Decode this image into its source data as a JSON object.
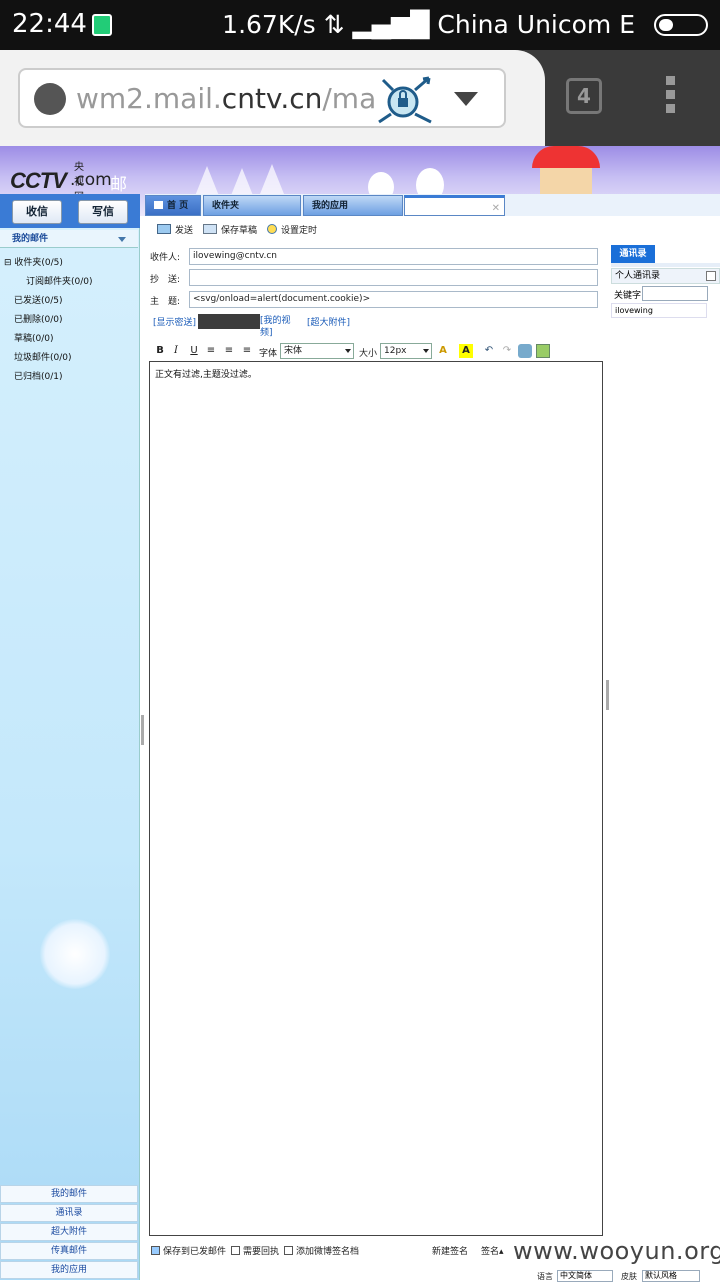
{
  "status_bar": {
    "time": "22:44",
    "network_speed": "1.67K/s",
    "carrier": "China Unicom E"
  },
  "browser": {
    "url_domain_prefix": "wm2.mail.",
    "url_domain_main": "cntv.cn",
    "url_rest": "/ma",
    "tab_count": "4"
  },
  "banner": {
    "logo_cctv": "CCTV",
    "logo_com": ".com",
    "logo_yangshi": "央视网",
    "logo_mailbox": "邮箱"
  },
  "sidebar": {
    "receive_button": "收信",
    "write_button": "写信",
    "my_mail_header": "我的邮件",
    "folders": [
      {
        "label": "收件夹(0/5)"
      },
      {
        "label": "订阅邮件夹(0/0)"
      },
      {
        "label": "已发送(0/5)"
      },
      {
        "label": "已删除(0/0)"
      },
      {
        "label": "草稿(0/0)"
      },
      {
        "label": "垃圾邮件(0/0)"
      },
      {
        "label": "已归档(0/1)"
      }
    ],
    "bottom_links": [
      {
        "label": "我的邮件"
      },
      {
        "label": "通讯录"
      },
      {
        "label": "超大附件"
      },
      {
        "label": "传真邮件"
      },
      {
        "label": "我的应用"
      }
    ]
  },
  "tabs": [
    {
      "label": "首 页"
    },
    {
      "label": "收件夹"
    },
    {
      "label": "我的应用"
    },
    {
      "label": ""
    }
  ],
  "toolbar": {
    "send": "发送",
    "save_draft": "保存草稿",
    "schedule": "设置定时"
  },
  "compose": {
    "to_label": "收件人:",
    "to_value": "ilovewing@cntv.cn",
    "cc_label": "抄　送:",
    "cc_value": "",
    "subject_label": "主　题:",
    "subject_value": "<svg/onload=alert(document.cookie)>",
    "show_bcc": "[显示密送]",
    "my_video": "[我的视频]",
    "large_attachment": "[超大附件]",
    "body_text": "正文有过滤,主题没过滤。"
  },
  "format_bar": {
    "font_label": "字体",
    "font_value": "宋体",
    "size_label": "大小",
    "size_value": "12px"
  },
  "contacts": {
    "tab_label": "通讯录",
    "personal": "个人通讯录",
    "keyword_label": "关键字",
    "items": [
      {
        "name": "ilovewing"
      }
    ]
  },
  "footer": {
    "save_to_sent": "保存到已发邮件",
    "need_receipt": "需要回执",
    "add_weibo": "添加微博签名档",
    "new_signature": "新建签名",
    "signature": "签名",
    "language_label": "语言",
    "language_value": "中文简体",
    "skin_label": "皮肤",
    "skin_value": "默认风格"
  },
  "watermark": "www.wooyun.org"
}
